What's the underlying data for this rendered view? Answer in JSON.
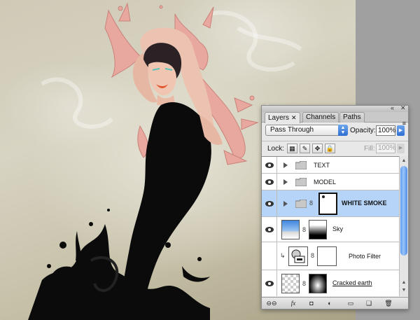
{
  "panel": {
    "titlebar": {
      "collapse_icon": "double-arrow-icon",
      "close_icon": "close-icon",
      "collapse_glyph": "«",
      "close_glyph": "✕"
    },
    "tabs": [
      {
        "label": "Layers",
        "active": true
      },
      {
        "label": "Channels",
        "active": false
      },
      {
        "label": "Paths",
        "active": false
      }
    ],
    "tab_close_glyph": "✕",
    "menu_glyph": "≡",
    "blend_mode": "Pass Through",
    "opacity_label": "Opacity:",
    "opacity_value": "100%",
    "lock_label": "Lock:",
    "fill_label": "Fill:",
    "fill_value": "100%",
    "layers": [
      {
        "name": "TEXT",
        "type": "group"
      },
      {
        "name": "MODEL",
        "type": "group"
      },
      {
        "name": "WHITE SMOKE",
        "type": "group",
        "selected": true,
        "has_mask": true
      },
      {
        "name": "Sky",
        "type": "layer",
        "has_mask": true
      },
      {
        "name": "Photo Filter",
        "type": "adjustment",
        "clipped": true,
        "has_mask": true
      },
      {
        "name": "Cracked earth",
        "type": "layer",
        "has_mask": true
      }
    ],
    "bottom_buttons": [
      {
        "icon": "link-icon",
        "glyph": "⊖⊖"
      },
      {
        "icon": "fx-icon",
        "glyph": "fx"
      },
      {
        "icon": "add-mask-icon",
        "glyph": "◘"
      },
      {
        "icon": "adjustment-layer-icon",
        "glyph": "◐"
      },
      {
        "icon": "new-group-icon",
        "glyph": "▭"
      },
      {
        "icon": "new-layer-icon",
        "glyph": "❑"
      },
      {
        "icon": "trash-icon",
        "glyph": "🗑"
      }
    ]
  }
}
